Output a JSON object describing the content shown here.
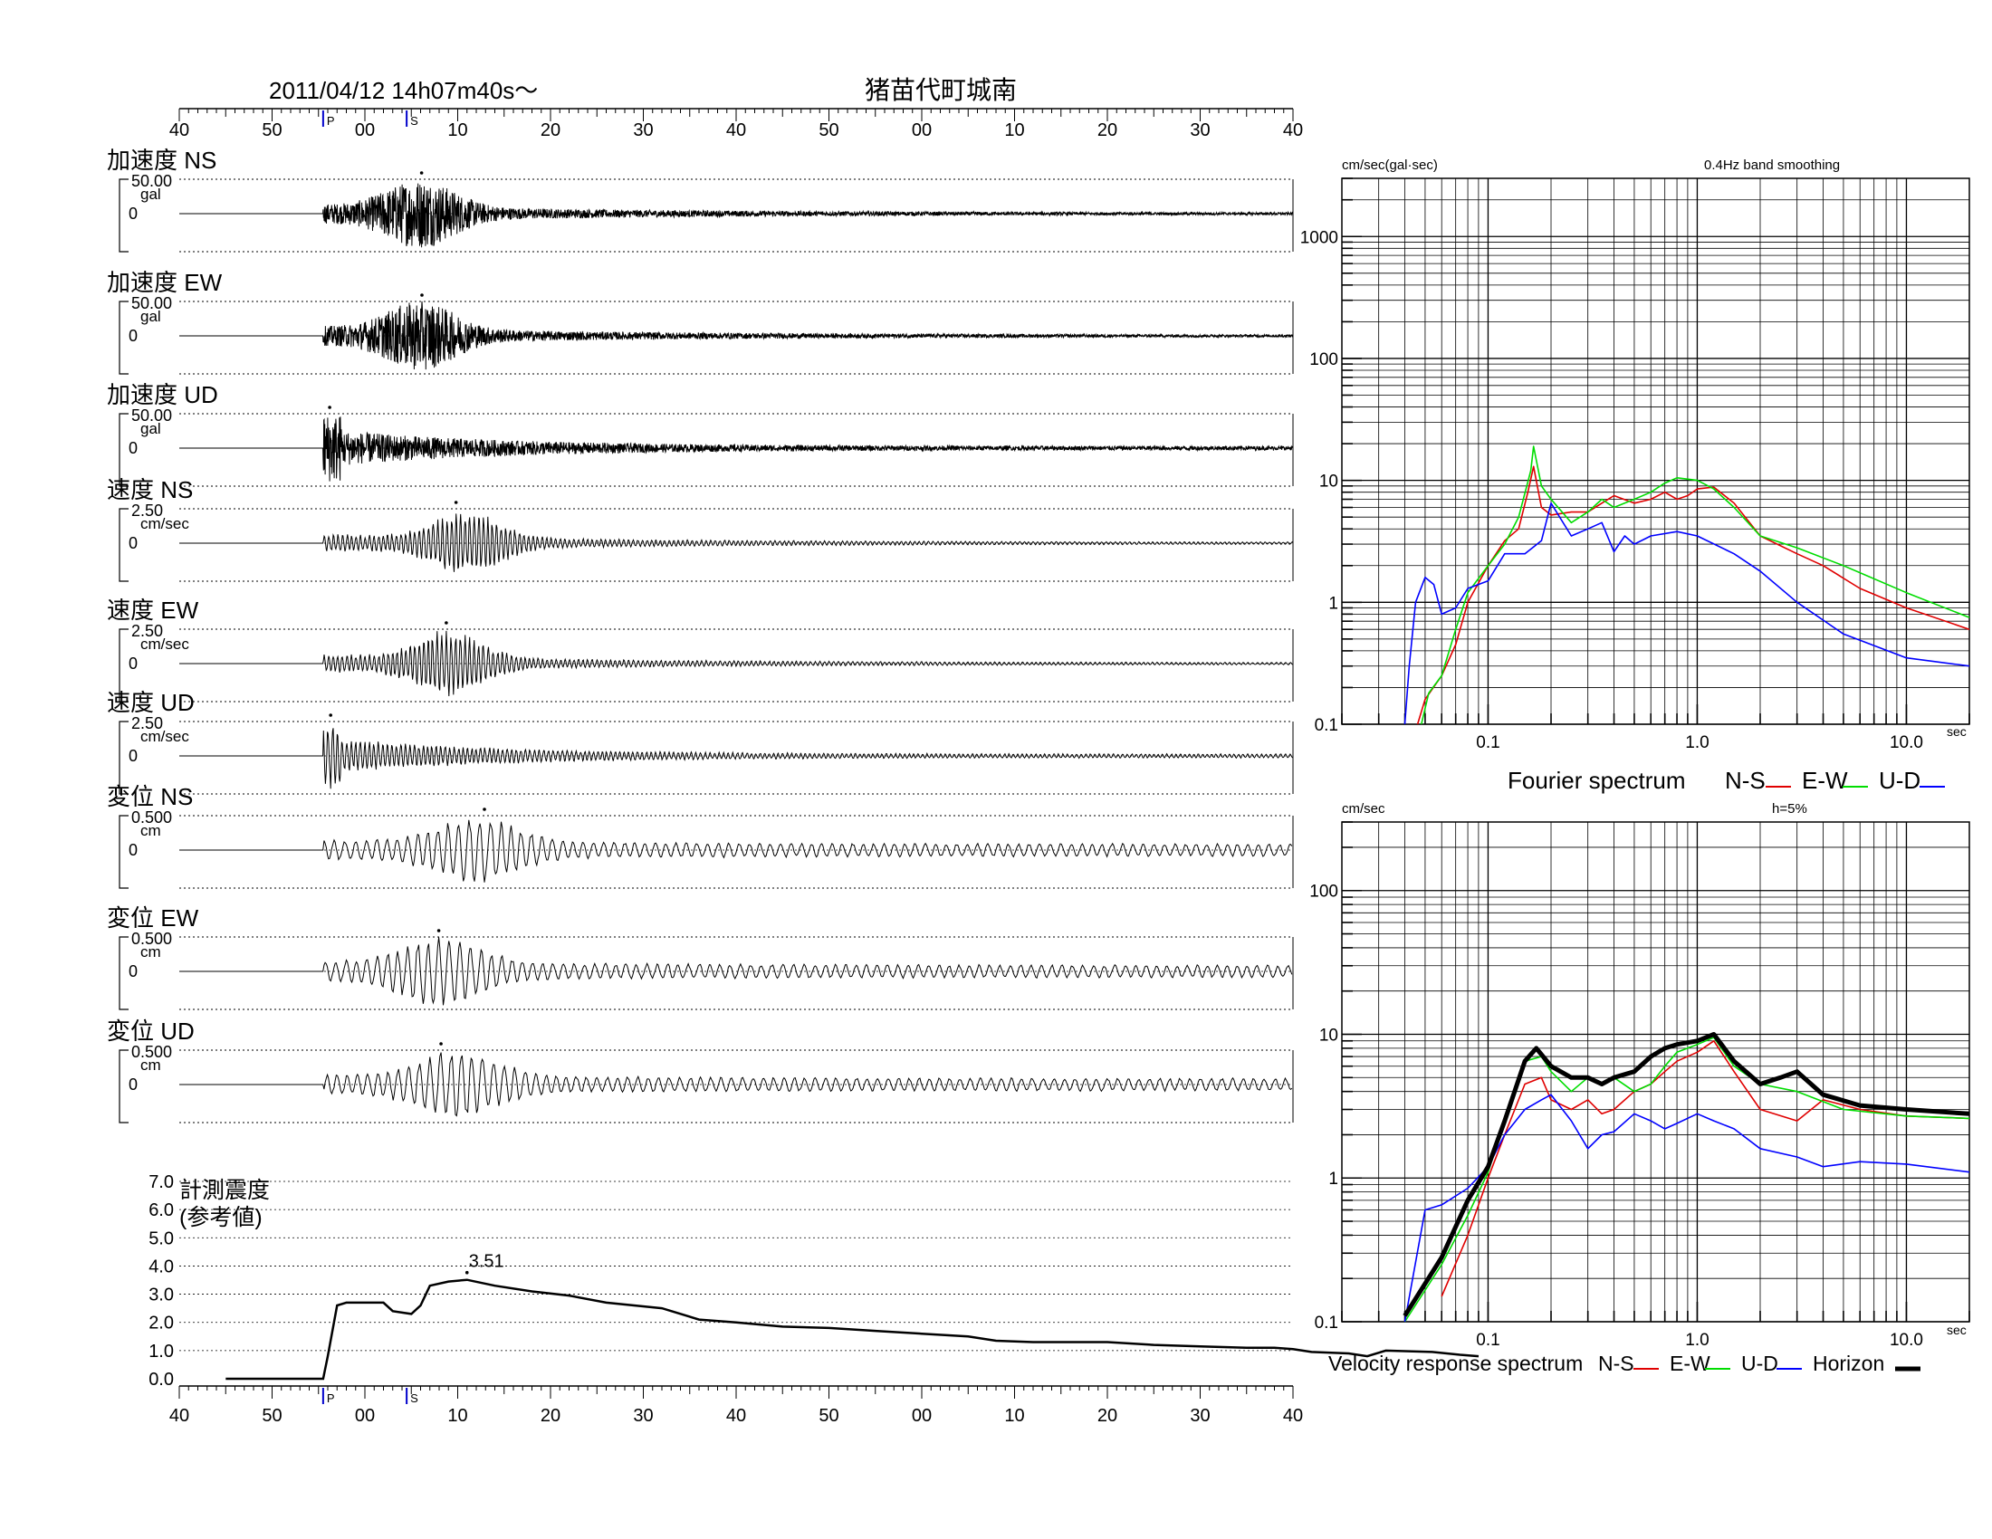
{
  "header": {
    "datetime": "2011/04/12  14h07m40s〜",
    "station": "猪苗代町城南"
  },
  "time_axis": {
    "tick_labels": [
      "40",
      "50",
      "00",
      "10",
      "20",
      "30",
      "40",
      "50",
      "00",
      "10",
      "20",
      "30",
      "40"
    ],
    "p_marker": "P",
    "s_marker": "S",
    "p_arrival_sec": 15.5,
    "s_arrival_sec": 24.5
  },
  "colors": {
    "ns": "#e00000",
    "ew": "#00dd00",
    "ud": "#0000ff",
    "horizon": "#000000",
    "marker": "#0000cc"
  },
  "chart_data": [
    {
      "type": "line",
      "panels": [
        {
          "label": "加速度 NS",
          "scale": "50.00",
          "unit": "gal",
          "zero": "0",
          "onset": 15.5,
          "peak_t": 26,
          "env": "acc"
        },
        {
          "label": "加速度 EW",
          "scale": "50.00",
          "unit": "gal",
          "zero": "0",
          "onset": 15.5,
          "peak_t": 26,
          "env": "acc"
        },
        {
          "label": "加速度 UD",
          "scale": "50.00",
          "unit": "gal",
          "zero": "0",
          "onset": 15.5,
          "peak_t": 17,
          "env": "accud"
        },
        {
          "label": "速度 NS",
          "scale": "2.50",
          "unit": "cm/sec",
          "zero": "0",
          "onset": 15.5,
          "peak_t": 31,
          "env": "vel"
        },
        {
          "label": "速度 EW",
          "scale": "2.50",
          "unit": "cm/sec",
          "zero": "0",
          "onset": 15.5,
          "peak_t": 29,
          "env": "vel"
        },
        {
          "label": "速度 UD",
          "scale": "2.50",
          "unit": "cm/sec",
          "zero": "0",
          "onset": 15.5,
          "peak_t": 17,
          "env": "velud"
        },
        {
          "label": "変位 NS",
          "scale": "0.500",
          "unit": "cm",
          "zero": "0",
          "onset": 15.5,
          "peak_t": 32,
          "env": "disp"
        },
        {
          "label": "変位 EW",
          "scale": "0.500",
          "unit": "cm",
          "zero": "0",
          "onset": 15.5,
          "peak_t": 28,
          "env": "disp"
        },
        {
          "label": "変位 UD",
          "scale": "0.500",
          "unit": "cm",
          "zero": "0",
          "onset": 15.5,
          "peak_t": 30,
          "env": "dispud"
        }
      ]
    },
    {
      "type": "line",
      "label_line1": "計測震度",
      "label_line2": "(参考値)",
      "peak_label": "3.51",
      "ylim": [
        0,
        7
      ],
      "y_ticks": [
        "7.0",
        "6.0",
        "5.0",
        "4.0",
        "3.0",
        "2.0",
        "1.0",
        "0.0"
      ],
      "points": [
        [
          5,
          0
        ],
        [
          15.5,
          0
        ],
        [
          16,
          0.8
        ],
        [
          17,
          2.6
        ],
        [
          18,
          2.7
        ],
        [
          22,
          2.7
        ],
        [
          23,
          2.4
        ],
        [
          25,
          2.3
        ],
        [
          26,
          2.6
        ],
        [
          27,
          3.3
        ],
        [
          29,
          3.45
        ],
        [
          31,
          3.51
        ],
        [
          34,
          3.3
        ],
        [
          38,
          3.1
        ],
        [
          42,
          2.95
        ],
        [
          46,
          2.7
        ],
        [
          52,
          2.5
        ],
        [
          56,
          2.1
        ],
        [
          60,
          2.0
        ],
        [
          65,
          1.85
        ],
        [
          70,
          1.8
        ],
        [
          75,
          1.7
        ],
        [
          80,
          1.6
        ],
        [
          85,
          1.5
        ],
        [
          88,
          1.35
        ],
        [
          92,
          1.3
        ],
        [
          96,
          1.3
        ],
        [
          100,
          1.3
        ],
        [
          105,
          1.2
        ],
        [
          110,
          1.15
        ],
        [
          115,
          1.1
        ],
        [
          118,
          1.1
        ],
        [
          120,
          1.05
        ],
        [
          122,
          0.95
        ],
        [
          126,
          0.9
        ],
        [
          128,
          0.8
        ],
        [
          130,
          1.0
        ],
        [
          135,
          0.95
        ],
        [
          138,
          0.85
        ],
        [
          140,
          0.8
        ]
      ]
    },
    {
      "type": "line",
      "title": "Fourier spectrum",
      "unit_label": "cm/sec(gal·sec)",
      "note": "0.4Hz band smoothing",
      "x_unit": "sec",
      "x_ticks": [
        "0.1",
        "1.0",
        "10.0"
      ],
      "y_ticks": [
        "1000",
        "100",
        "10",
        "1",
        "0.1"
      ],
      "xlim": [
        0.02,
        20
      ],
      "ylim": [
        0.1,
        3000
      ],
      "series": [
        {
          "name": "N-S",
          "color": "#e00000",
          "points": [
            [
              0.046,
              0.1
            ],
            [
              0.05,
              0.16
            ],
            [
              0.06,
              0.25
            ],
            [
              0.07,
              0.45
            ],
            [
              0.08,
              1.0
            ],
            [
              0.1,
              2.0
            ],
            [
              0.12,
              3.2
            ],
            [
              0.14,
              4.0
            ],
            [
              0.155,
              8
            ],
            [
              0.165,
              13
            ],
            [
              0.18,
              6
            ],
            [
              0.2,
              5.2
            ],
            [
              0.25,
              5.5
            ],
            [
              0.3,
              5.5
            ],
            [
              0.35,
              6.5
            ],
            [
              0.4,
              7.5
            ],
            [
              0.5,
              6.5
            ],
            [
              0.6,
              7.0
            ],
            [
              0.7,
              8.0
            ],
            [
              0.8,
              7.0
            ],
            [
              0.9,
              7.5
            ],
            [
              1.0,
              8.5
            ],
            [
              1.2,
              8.8
            ],
            [
              1.5,
              6.5
            ],
            [
              2,
              3.5
            ],
            [
              3,
              2.5
            ],
            [
              4,
              2.0
            ],
            [
              6,
              1.3
            ],
            [
              10,
              0.9
            ],
            [
              20,
              0.6
            ]
          ]
        },
        {
          "name": "E-W",
          "color": "#00dd00",
          "points": [
            [
              0.048,
              0.1
            ],
            [
              0.052,
              0.18
            ],
            [
              0.06,
              0.25
            ],
            [
              0.07,
              0.6
            ],
            [
              0.08,
              1.2
            ],
            [
              0.1,
              2.0
            ],
            [
              0.12,
              3.0
            ],
            [
              0.14,
              5.0
            ],
            [
              0.16,
              12
            ],
            [
              0.165,
              19
            ],
            [
              0.18,
              9
            ],
            [
              0.2,
              7
            ],
            [
              0.25,
              4.5
            ],
            [
              0.3,
              5.5
            ],
            [
              0.35,
              7
            ],
            [
              0.4,
              6.0
            ],
            [
              0.5,
              7.0
            ],
            [
              0.6,
              8.0
            ],
            [
              0.7,
              9.5
            ],
            [
              0.8,
              10.5
            ],
            [
              1.0,
              10
            ],
            [
              1.2,
              8.5
            ],
            [
              1.5,
              6
            ],
            [
              2,
              3.5
            ],
            [
              3,
              2.8
            ],
            [
              5,
              2.0
            ],
            [
              10,
              1.2
            ],
            [
              20,
              0.75
            ]
          ]
        },
        {
          "name": "U-D",
          "color": "#0000ff",
          "points": [
            [
              0.04,
              0.1
            ],
            [
              0.042,
              0.3
            ],
            [
              0.045,
              1.0
            ],
            [
              0.05,
              1.6
            ],
            [
              0.055,
              1.4
            ],
            [
              0.06,
              0.8
            ],
            [
              0.07,
              0.9
            ],
            [
              0.08,
              1.3
            ],
            [
              0.1,
              1.5
            ],
            [
              0.12,
              2.5
            ],
            [
              0.15,
              2.5
            ],
            [
              0.18,
              3.2
            ],
            [
              0.2,
              6.5
            ],
            [
              0.25,
              3.5
            ],
            [
              0.3,
              4.0
            ],
            [
              0.35,
              4.5
            ],
            [
              0.4,
              2.6
            ],
            [
              0.45,
              3.5
            ],
            [
              0.5,
              3.0
            ],
            [
              0.6,
              3.5
            ],
            [
              0.8,
              3.8
            ],
            [
              1.0,
              3.5
            ],
            [
              1.5,
              2.5
            ],
            [
              2,
              1.8
            ],
            [
              3,
              1.0
            ],
            [
              5,
              0.55
            ],
            [
              10,
              0.35
            ],
            [
              20,
              0.3
            ]
          ]
        }
      ]
    },
    {
      "type": "line",
      "title": "Velocity response spectrum",
      "unit_label": "cm/sec",
      "note": "h=5%",
      "x_unit": "sec",
      "x_ticks": [
        "0.1",
        "1.0",
        "10.0"
      ],
      "y_ticks": [
        "100",
        "10",
        "1",
        "0.1"
      ],
      "xlim": [
        0.02,
        20
      ],
      "ylim": [
        0.1,
        300
      ],
      "series": [
        {
          "name": "N-S",
          "color": "#e00000",
          "points": [
            [
              0.06,
              0.15
            ],
            [
              0.08,
              0.4
            ],
            [
              0.1,
              1.0
            ],
            [
              0.12,
              2.0
            ],
            [
              0.15,
              4.5
            ],
            [
              0.18,
              5.0
            ],
            [
              0.2,
              3.5
            ],
            [
              0.25,
              3.0
            ],
            [
              0.3,
              3.5
            ],
            [
              0.35,
              2.8
            ],
            [
              0.4,
              3.0
            ],
            [
              0.5,
              4.0
            ],
            [
              0.6,
              4.5
            ],
            [
              0.7,
              5.5
            ],
            [
              0.8,
              6.5
            ],
            [
              1.0,
              7.5
            ],
            [
              1.2,
              9.0
            ],
            [
              1.5,
              5.5
            ],
            [
              2,
              3.0
            ],
            [
              3,
              2.5
            ],
            [
              4,
              3.5
            ],
            [
              6,
              3.0
            ],
            [
              10,
              2.7
            ],
            [
              20,
              2.6
            ]
          ]
        },
        {
          "name": "E-W",
          "color": "#00dd00",
          "points": [
            [
              0.04,
              0.1
            ],
            [
              0.06,
              0.25
            ],
            [
              0.08,
              0.55
            ],
            [
              0.1,
              1.1
            ],
            [
              0.12,
              2.5
            ],
            [
              0.15,
              6.5
            ],
            [
              0.18,
              7.0
            ],
            [
              0.2,
              5.5
            ],
            [
              0.25,
              4.0
            ],
            [
              0.3,
              5.0
            ],
            [
              0.35,
              4.5
            ],
            [
              0.4,
              5.0
            ],
            [
              0.5,
              4.0
            ],
            [
              0.6,
              4.5
            ],
            [
              0.7,
              6.0
            ],
            [
              0.8,
              7.5
            ],
            [
              1.0,
              8.5
            ],
            [
              1.2,
              9.5
            ],
            [
              1.5,
              6.0
            ],
            [
              2,
              4.5
            ],
            [
              3,
              4.0
            ],
            [
              5,
              3.0
            ],
            [
              10,
              2.7
            ],
            [
              20,
              2.6
            ]
          ]
        },
        {
          "name": "U-D",
          "color": "#0000ff",
          "points": [
            [
              0.04,
              0.1
            ],
            [
              0.05,
              0.6
            ],
            [
              0.06,
              0.65
            ],
            [
              0.08,
              0.85
            ],
            [
              0.1,
              1.2
            ],
            [
              0.12,
              2.0
            ],
            [
              0.15,
              3.0
            ],
            [
              0.18,
              3.5
            ],
            [
              0.2,
              3.8
            ],
            [
              0.25,
              2.5
            ],
            [
              0.3,
              1.6
            ],
            [
              0.35,
              2.0
            ],
            [
              0.4,
              2.1
            ],
            [
              0.5,
              2.8
            ],
            [
              0.6,
              2.5
            ],
            [
              0.7,
              2.2
            ],
            [
              0.8,
              2.4
            ],
            [
              1.0,
              2.8
            ],
            [
              1.2,
              2.5
            ],
            [
              1.5,
              2.2
            ],
            [
              2,
              1.6
            ],
            [
              3,
              1.4
            ],
            [
              4,
              1.2
            ],
            [
              6,
              1.3
            ],
            [
              10,
              1.25
            ],
            [
              20,
              1.1
            ]
          ]
        },
        {
          "name": "Horizon",
          "color": "#000000",
          "points": [
            [
              0.04,
              0.11
            ],
            [
              0.06,
              0.28
            ],
            [
              0.08,
              0.7
            ],
            [
              0.1,
              1.2
            ],
            [
              0.12,
              2.5
            ],
            [
              0.15,
              6.5
            ],
            [
              0.17,
              8.0
            ],
            [
              0.2,
              6.0
            ],
            [
              0.25,
              5.0
            ],
            [
              0.3,
              5.0
            ],
            [
              0.35,
              4.5
            ],
            [
              0.4,
              5.0
            ],
            [
              0.5,
              5.5
            ],
            [
              0.6,
              7.0
            ],
            [
              0.7,
              8.0
            ],
            [
              0.8,
              8.5
            ],
            [
              1.0,
              9.0
            ],
            [
              1.2,
              10.0
            ],
            [
              1.5,
              6.5
            ],
            [
              2,
              4.5
            ],
            [
              2.5,
              5.0
            ],
            [
              3,
              5.5
            ],
            [
              4,
              3.8
            ],
            [
              6,
              3.2
            ],
            [
              10,
              3.0
            ],
            [
              20,
              2.8
            ]
          ]
        }
      ]
    }
  ]
}
